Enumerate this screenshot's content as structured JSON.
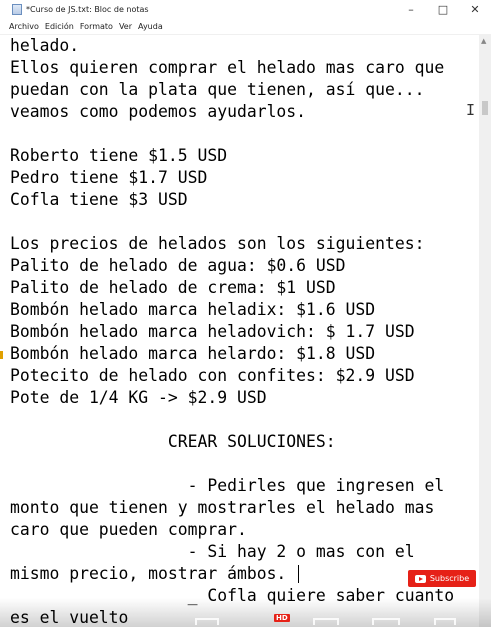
{
  "window": {
    "title": "*Curso de JS.txt: Bloc de notas",
    "minimize_label": "–",
    "maximize_label": "□",
    "close_label": "✕"
  },
  "menu": [
    "Archivo",
    "Edición",
    "Formato",
    "Ver",
    "Ayuda"
  ],
  "editor": {
    "lines": [
      "helado.",
      "Ellos quieren comprar el helado mas caro que",
      "puedan con la plata que tienen, así que...",
      "veamos como podemos ayudarlos.",
      "",
      "Roberto tiene $1.5 USD",
      "Pedro tiene $1.7 USD",
      "Cofla tiene $3 USD",
      "",
      "Los precios de helados son los siguientes:",
      "Palito de helado de agua: $0.6 USD",
      "Palito de helado de crema: $1 USD",
      "Bombón helado marca heladix: $1.6 USD",
      "Bombón helado marca heladovich: $ 1.7 USD",
      "Bombón helado marca helardo: $1.8 USD",
      "Potecito de helado con confites: $2.9 USD",
      "Pote de 1/4 KG -> $2.9 USD",
      "",
      "                CREAR SOLUCIONES:",
      "",
      "                  - Pedirles que ingresen el",
      "monto que tienen y mostrarles el helado mas",
      "caro que pueden comprar.",
      "                  - Si hay 2 o mas con el",
      "mismo precio, mostrar ámbos.",
      "                  _ Cofla quiere saber cuanto",
      "es el vuelto"
    ]
  },
  "overlay": {
    "subscribe_label": "Subscribe",
    "hd_label": "HD"
  },
  "colors": {
    "subscribe_bg": "#e62117",
    "text": "#000000",
    "background": "#ffffff"
  }
}
